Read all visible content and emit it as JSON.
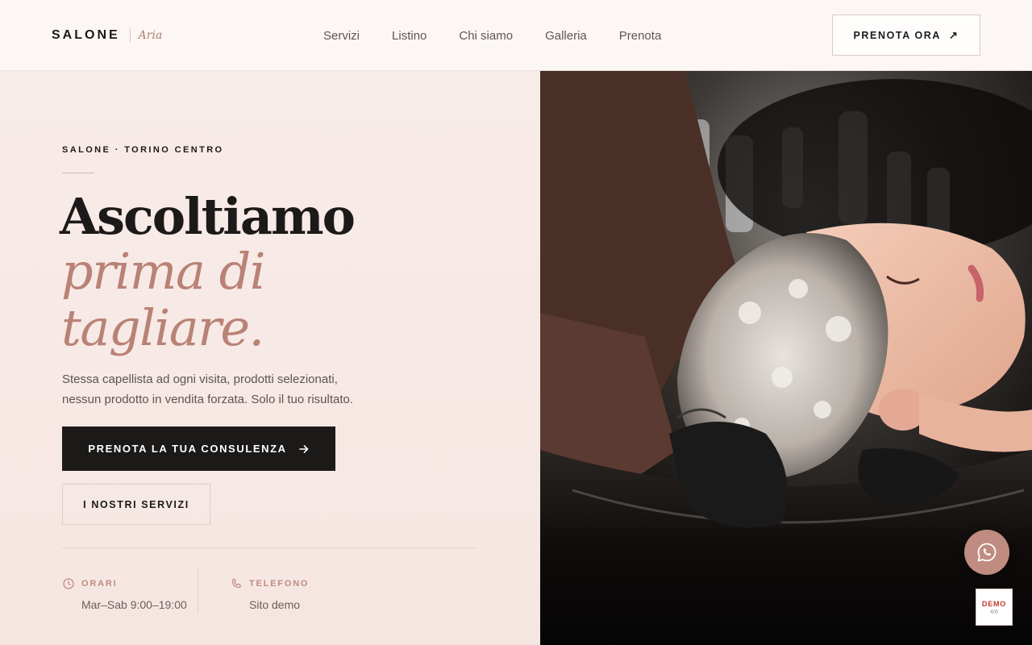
{
  "header": {
    "brand_name": "SALONE",
    "brand_sub": "Aria",
    "nav": [
      "Servizi",
      "Listino",
      "Chi siamo",
      "Galleria",
      "Prenota"
    ],
    "cta_label": "PRENOTA ORA",
    "cta_icon": "arrow-up-right-icon"
  },
  "hero": {
    "eyebrow": "SALONE · TORINO CENTRO",
    "headline_line1": "Ascoltiamo",
    "headline_line2": "prima di",
    "headline_line3": "tagliare.",
    "lead_line1": "Stessa capellista ad ogni visita, prodotti selezionati,",
    "lead_line2": "nessun prodotto in vendita forzata. Solo il tuo risultato.",
    "primary_button": "PRENOTA LA TUA CONSULENZA",
    "primary_button_icon": "arrow-right-icon",
    "secondary_button": "I NOSTRI SERVIZI",
    "info": {
      "hours_label": "ORARI",
      "hours_value": "Mar–Sab 9:00–19:00",
      "hours_icon": "clock-icon",
      "phone_label": "TELEFONO",
      "phone_value": "Sito demo",
      "phone_icon": "phone-icon"
    }
  },
  "floating": {
    "whatsapp_icon": "whatsapp-icon",
    "demo_label": "DEMO",
    "demo_count": "4/6"
  },
  "colors": {
    "accent": "#b98276",
    "dark": "#1c1a19",
    "hero_bg": "#f7e9e5",
    "header_bg": "#fcf7f4"
  }
}
